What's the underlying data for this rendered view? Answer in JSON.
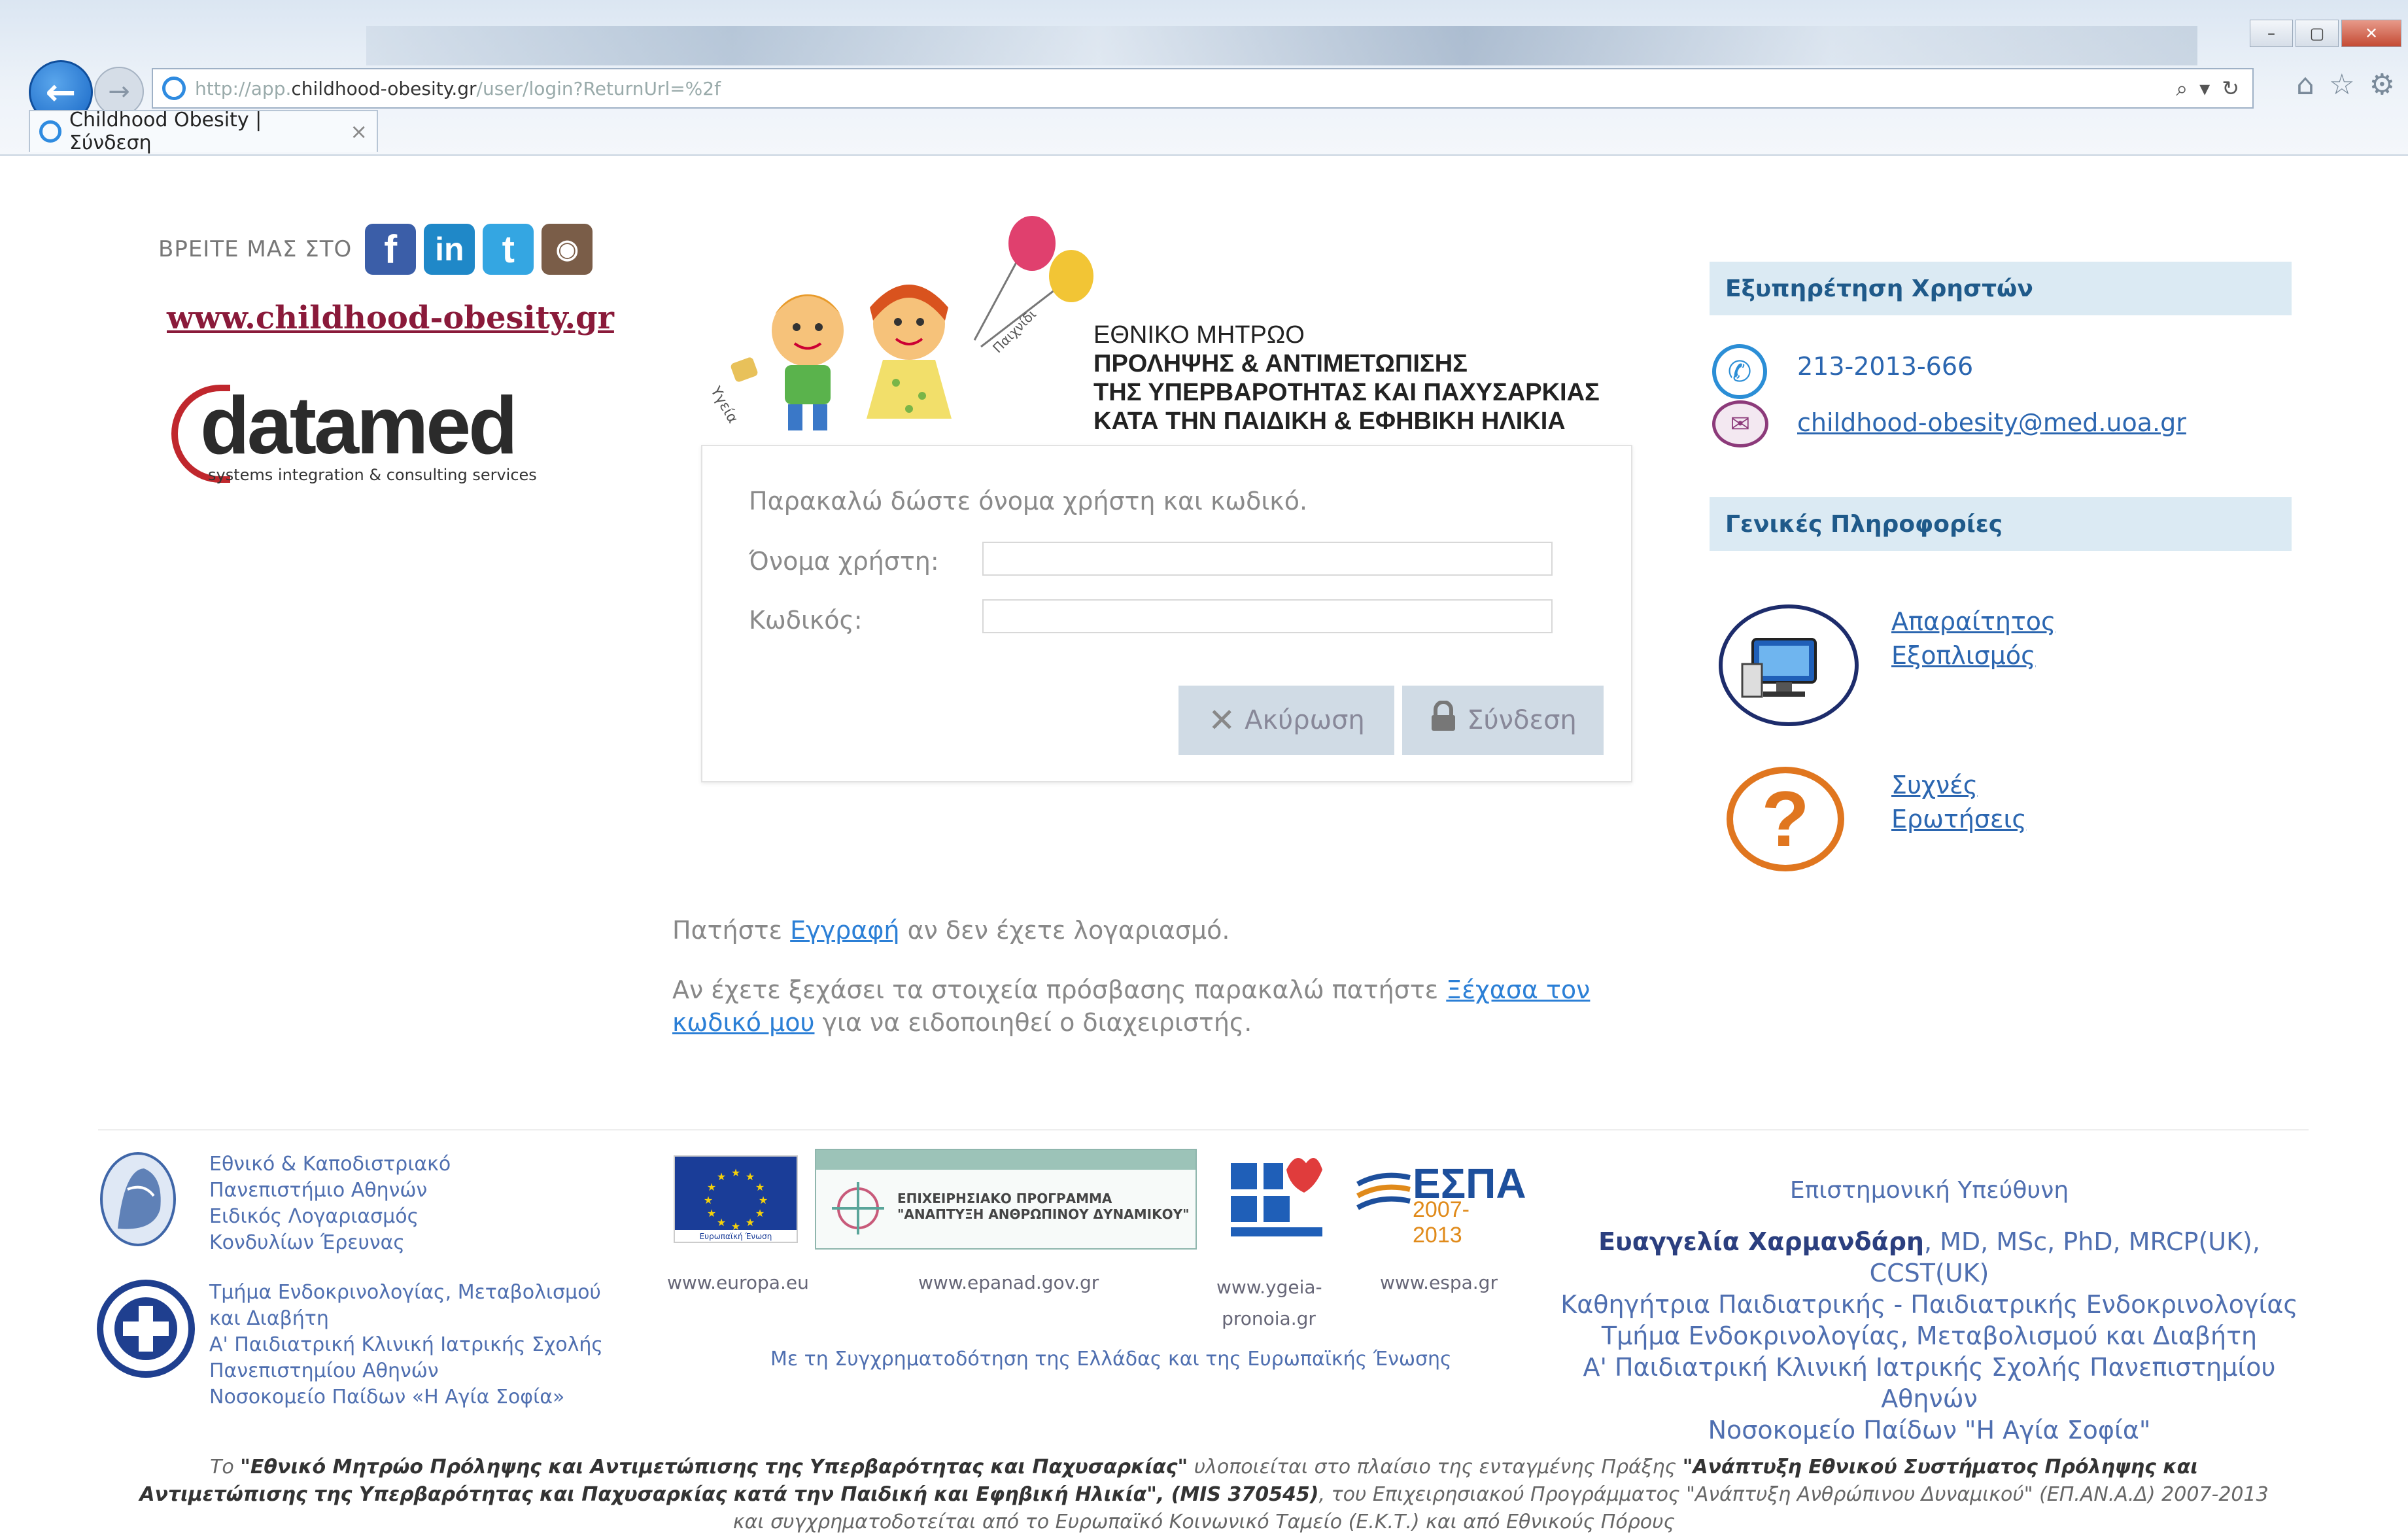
{
  "browser": {
    "url_prefix": "http://app.",
    "url_domain": "childhood-obesity.gr",
    "url_path": "/user/login?ReturnUrl=%2f",
    "tab_title": "Childhood Obesity | Σύνδεση",
    "tab_close": "×"
  },
  "header": {
    "find_us_label": "ΒΡΕΙΤΕ ΜΑΣ ΣΤΟ",
    "site_link": "www.childhood-obesity.gr",
    "datamed_word": "datamed",
    "datamed_tagline": "systems integration & consulting services",
    "registry_title": [
      "ΕΘΝΙΚΟ ΜΗΤΡΩΟ",
      "ΠΡΟΛΗΨΗΣ & ΑΝΤΙΜΕΤΩΠΙΣΗΣ",
      "ΤΗΣ ΥΠΕΡΒΑΡΟΤΗΤΑΣ ΚΑΙ ΠΑΧΥΣΑΡΚΙΑΣ",
      "ΚΑΤΑ ΤΗΝ ΠΑΙΔΙΚΗ & ΕΦΗΒΙΚΗ ΗΛΙΚΙΑ"
    ]
  },
  "login": {
    "prompt": "Παρακαλώ δώστε όνομα χρήστη και κωδικό.",
    "username_label": "Όνομα χρήστη:",
    "username_value": "",
    "password_label": "Κωδικός:",
    "password_value": "",
    "cancel_label": "Ακύρωση",
    "login_label": "Σύνδεση"
  },
  "links": {
    "register_before": "Πατήστε ",
    "register_link": "Εγγραφή",
    "register_after": " αν δεν έχετε λογαριασμό.",
    "forgot_before": "Αν έχετε ξεχάσει τα στοιχεία πρόσβασης παρακαλώ πατήστε ",
    "forgot_link": "Ξέχασα τον κωδικό μου",
    "forgot_after": " για να ειδοποιηθεί ο διαχειριστής."
  },
  "sidebar": {
    "support_heading": "Εξυπηρέτηση Χρηστών",
    "phone": "213-2013-666",
    "email": "childhood-obesity@med.uoa.gr",
    "info_heading": "Γενικές Πληροφορίες",
    "equipment_link": "Απαραίτητος Εξοπλισμός",
    "faq_link": "Συχνές Ερωτήσεις"
  },
  "footer": {
    "uoa_lines": [
      "Εθνικό & Καποδιστριακό",
      "Πανεπιστήμιο Αθηνών",
      "Ειδικός Λογαριασμός",
      "Κονδυλίων Έρευνας"
    ],
    "hospital_lines": [
      "Τμήμα Ενδοκρινολογίας, Μεταβολισμού",
      "και Διαβήτη",
      "Α' Παιδιατρική Κλινική Ιατρικής Σχολής",
      "Πανεπιστημίου Αθηνών",
      "Νοσοκομείο Παίδων «Η Αγία Σοφία»"
    ],
    "eu_caption": "Ευρωπαϊκή Ένωση",
    "epanad_text": "ΕΠΙΧΕΙΡΗΣΙΑΚΟ ΠΡΟΓΡΑΜΜΑ \"ΑΝΑΠΤΥΞΗ ΑΝΘΡΩΠΙΝΟΥ ΔΥΝΑΜΙΚΟΥ\"",
    "espa_word": "ΕΣΠΑ",
    "espa_years": "2007-2013",
    "url_eu": "www.europa.eu",
    "url_epanad": "www.epanad.gov.gr",
    "url_ygeia": "www.ygeia-pronoia.gr",
    "url_espa": "www.espa.gr",
    "cofund": "Με τη Συγχρηματοδότηση της Ελλάδας και της Ευρωπαϊκής Ένωσης",
    "resp_title": "Επιστημονική Υπεύθυνη",
    "resp_name": "Ευαγγελία Χαρμανδάρη",
    "resp_degrees": ", MD, MSc, PhD, MRCP(UK), CCST(UK)",
    "resp_lines": [
      "Καθηγήτρια Παιδιατρικής - Παιδιατρικής Ενδοκρινολογίας",
      "Τμήμα Ενδοκρινολογίας, Μεταβολισμού και Διαβήτη",
      "Α' Παιδιατρική Κλινική Ιατρικής Σχολής Πανεπιστημίου Αθηνών",
      "Νοσοκομείο Παίδων \"Η Αγία Σοφία\""
    ],
    "note_1": "Το ",
    "note_b1": "\"Εθνικό Μητρώο Πρόληψης και Αντιμετώπισης της Υπερβαρότητας και Παχυσαρκίας\"",
    "note_2": " υλοποιείται στο πλαίσιο της ενταγμένης Πράξης ",
    "note_b2": "\"Ανάπτυξη Εθνικού Συστήματος Πρόληψης και Αντιμετώπισης της Υπερβαρότητας και Παχυσαρκίας κατά την Παιδική και Εφηβική Ηλικία\", (MIS 370545)",
    "note_3": ", του Επιχειρησιακού Προγράμματος \"Ανάπτυξη Ανθρώπινου Δυναμικού\" (ΕΠ.ΑΝ.Α.Δ) 2007-2013 και συγχρηματοδοτείται από το Ευρωπαϊκό Κοινωνικό Ταμείο (Ε.Κ.Τ.) και από Εθνικούς Πόρους"
  },
  "icons": {
    "back": "back-arrow-icon",
    "search": "search-icon",
    "refresh": "refresh-icon",
    "home": "home-icon",
    "favorites": "star-icon",
    "settings": "gear-icon",
    "phone": "phone-icon",
    "mail": "mail-icon",
    "faq": "question-icon"
  },
  "colors": {
    "link": "#2b7fd6",
    "panel_heading_bg": "#dbeaf3",
    "button_bg": "#d0dbe5",
    "site_link": "#8a1a3a"
  }
}
